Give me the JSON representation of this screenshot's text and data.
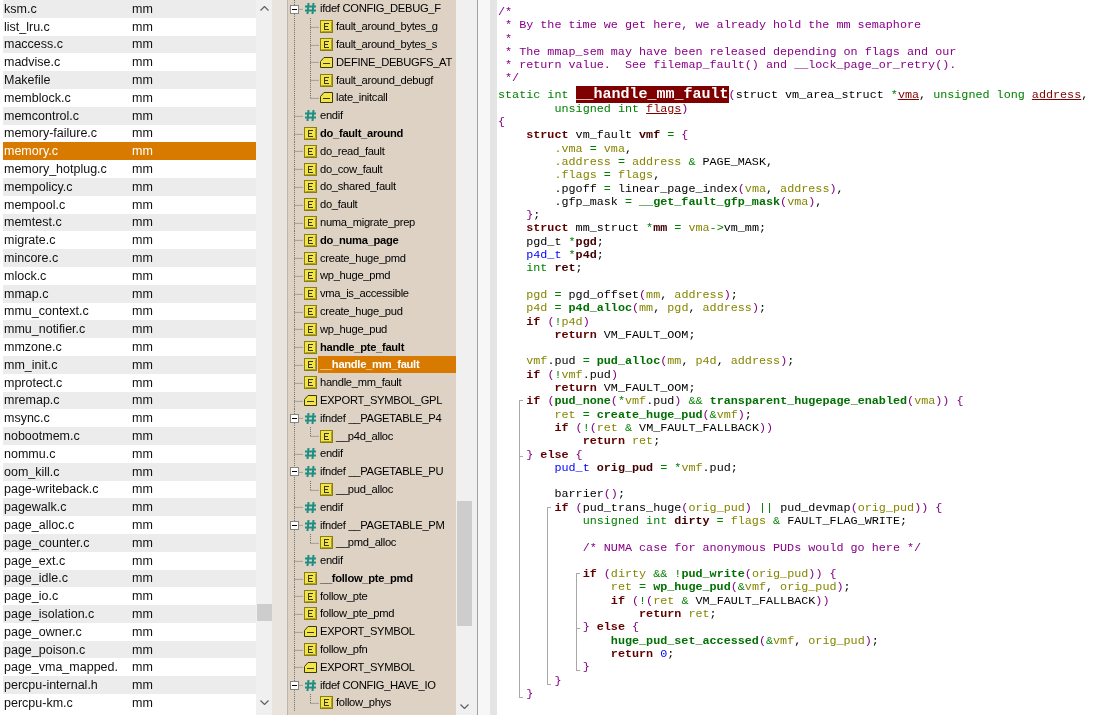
{
  "file_list": {
    "rows": [
      {
        "column_1": "ksm.c",
        "column_2": "mm",
        "selected": false
      },
      {
        "column_1": "list_lru.c",
        "column_2": "mm",
        "selected": false
      },
      {
        "column_1": "maccess.c",
        "column_2": "mm",
        "selected": false
      },
      {
        "column_1": "madvise.c",
        "column_2": "mm",
        "selected": false
      },
      {
        "column_1": "Makefile",
        "column_2": "mm",
        "selected": false
      },
      {
        "column_1": "memblock.c",
        "column_2": "mm",
        "selected": false
      },
      {
        "column_1": "memcontrol.c",
        "column_2": "mm",
        "selected": false
      },
      {
        "column_1": "memory-failure.c",
        "column_2": "mm",
        "selected": false
      },
      {
        "column_1": "memory.c",
        "column_2": "mm",
        "selected": true
      },
      {
        "column_1": "memory_hotplug.c",
        "column_2": "mm",
        "selected": false
      },
      {
        "column_1": "mempolicy.c",
        "column_2": "mm",
        "selected": false
      },
      {
        "column_1": "mempool.c",
        "column_2": "mm",
        "selected": false
      },
      {
        "column_1": "memtest.c",
        "column_2": "mm",
        "selected": false
      },
      {
        "column_1": "migrate.c",
        "column_2": "mm",
        "selected": false
      },
      {
        "column_1": "mincore.c",
        "column_2": "mm",
        "selected": false
      },
      {
        "column_1": "mlock.c",
        "column_2": "mm",
        "selected": false
      },
      {
        "column_1": "mmap.c",
        "column_2": "mm",
        "selected": false
      },
      {
        "column_1": "mmu_context.c",
        "column_2": "mm",
        "selected": false
      },
      {
        "column_1": "mmu_notifier.c",
        "column_2": "mm",
        "selected": false
      },
      {
        "column_1": "mmzone.c",
        "column_2": "mm",
        "selected": false
      },
      {
        "column_1": "mm_init.c",
        "column_2": "mm",
        "selected": false
      },
      {
        "column_1": "mprotect.c",
        "column_2": "mm",
        "selected": false
      },
      {
        "column_1": "mremap.c",
        "column_2": "mm",
        "selected": false
      },
      {
        "column_1": "msync.c",
        "column_2": "mm",
        "selected": false
      },
      {
        "column_1": "nobootmem.c",
        "column_2": "mm",
        "selected": false
      },
      {
        "column_1": "nommu.c",
        "column_2": "mm",
        "selected": false
      },
      {
        "column_1": "oom_kill.c",
        "column_2": "mm",
        "selected": false
      },
      {
        "column_1": "page-writeback.c",
        "column_2": "mm",
        "selected": false
      },
      {
        "column_1": "pagewalk.c",
        "column_2": "mm",
        "selected": false
      },
      {
        "column_1": "page_alloc.c",
        "column_2": "mm",
        "selected": false
      },
      {
        "column_1": "page_counter.c",
        "column_2": "mm",
        "selected": false
      },
      {
        "column_1": "page_ext.c",
        "column_2": "mm",
        "selected": false
      },
      {
        "column_1": "page_idle.c",
        "column_2": "mm",
        "selected": false
      },
      {
        "column_1": "page_io.c",
        "column_2": "mm",
        "selected": false
      },
      {
        "column_1": "page_isolation.c",
        "column_2": "mm",
        "selected": false
      },
      {
        "column_1": "page_owner.c",
        "column_2": "mm",
        "selected": false
      },
      {
        "column_1": "page_poison.c",
        "column_2": "mm",
        "selected": false
      },
      {
        "column_1": "page_vma_mapped.",
        "column_2": "mm",
        "selected": false
      },
      {
        "column_1": "percpu-internal.h",
        "column_2": "mm",
        "selected": false
      },
      {
        "column_1": "percpu-km.c",
        "column_2": "mm",
        "selected": false
      }
    ]
  },
  "symbol_tree": {
    "items": [
      {
        "label": "ifdef CONFIG_DEBUG_F",
        "kind": "preprocessor",
        "bold": false,
        "selected": false,
        "expanded": true,
        "children": [
          {
            "label": "fault_around_bytes_g",
            "kind": "function",
            "bold": false,
            "selected": false
          },
          {
            "label": "fault_around_bytes_s",
            "kind": "function",
            "bold": false,
            "selected": false
          },
          {
            "label": "DEFINE_DEBUGFS_AT",
            "kind": "macro",
            "bold": false,
            "selected": false
          },
          {
            "label": "fault_around_debugf",
            "kind": "function",
            "bold": false,
            "selected": false
          },
          {
            "label": "late_initcall",
            "kind": "macro",
            "bold": false,
            "selected": false
          }
        ]
      },
      {
        "label": "endif",
        "kind": "preprocessor",
        "bold": false,
        "selected": false
      },
      {
        "label": "do_fault_around",
        "kind": "function",
        "bold": true,
        "selected": false
      },
      {
        "label": "do_read_fault",
        "kind": "function",
        "bold": false,
        "selected": false
      },
      {
        "label": "do_cow_fault",
        "kind": "function",
        "bold": false,
        "selected": false
      },
      {
        "label": "do_shared_fault",
        "kind": "function",
        "bold": false,
        "selected": false
      },
      {
        "label": "do_fault",
        "kind": "function",
        "bold": false,
        "selected": false
      },
      {
        "label": "numa_migrate_prep",
        "kind": "function",
        "bold": false,
        "selected": false
      },
      {
        "label": "do_numa_page",
        "kind": "function",
        "bold": true,
        "selected": false
      },
      {
        "label": "create_huge_pmd",
        "kind": "function",
        "bold": false,
        "selected": false
      },
      {
        "label": "wp_huge_pmd",
        "kind": "function",
        "bold": false,
        "selected": false
      },
      {
        "label": "vma_is_accessible",
        "kind": "function",
        "bold": false,
        "selected": false
      },
      {
        "label": "create_huge_pud",
        "kind": "function",
        "bold": false,
        "selected": false
      },
      {
        "label": "wp_huge_pud",
        "kind": "function",
        "bold": false,
        "selected": false
      },
      {
        "label": "handle_pte_fault",
        "kind": "function",
        "bold": true,
        "selected": false
      },
      {
        "label": "__handle_mm_fault",
        "kind": "function",
        "bold": true,
        "selected": true
      },
      {
        "label": "handle_mm_fault",
        "kind": "function",
        "bold": false,
        "selected": false
      },
      {
        "label": "EXPORT_SYMBOL_GPL",
        "kind": "macro",
        "bold": false,
        "selected": false
      },
      {
        "label": "ifndef __PAGETABLE_P4",
        "kind": "preprocessor",
        "bold": false,
        "selected": false,
        "expanded": true,
        "children": [
          {
            "label": "__p4d_alloc",
            "kind": "function",
            "bold": false,
            "selected": false
          }
        ]
      },
      {
        "label": "endif",
        "kind": "preprocessor",
        "bold": false,
        "selected": false
      },
      {
        "label": "ifndef __PAGETABLE_PU",
        "kind": "preprocessor",
        "bold": false,
        "selected": false,
        "expanded": true,
        "children": [
          {
            "label": "__pud_alloc",
            "kind": "function",
            "bold": false,
            "selected": false
          }
        ]
      },
      {
        "label": "endif",
        "kind": "preprocessor",
        "bold": false,
        "selected": false
      },
      {
        "label": "ifndef __PAGETABLE_PM",
        "kind": "preprocessor",
        "bold": false,
        "selected": false,
        "expanded": true,
        "children": [
          {
            "label": "__pmd_alloc",
            "kind": "function",
            "bold": false,
            "selected": false
          }
        ]
      },
      {
        "label": "endif",
        "kind": "preprocessor",
        "bold": false,
        "selected": false
      },
      {
        "label": "__follow_pte_pmd",
        "kind": "function",
        "bold": true,
        "selected": false
      },
      {
        "label": "follow_pte",
        "kind": "function",
        "bold": false,
        "selected": false
      },
      {
        "label": "follow_pte_pmd",
        "kind": "function",
        "bold": false,
        "selected": false
      },
      {
        "label": "EXPORT_SYMBOL",
        "kind": "macro",
        "bold": false,
        "selected": false
      },
      {
        "label": "follow_pfn",
        "kind": "function",
        "bold": false,
        "selected": false
      },
      {
        "label": "EXPORT_SYMBOL",
        "kind": "macro",
        "bold": false,
        "selected": false
      },
      {
        "label": "ifdef CONFIG_HAVE_IO",
        "kind": "preprocessor",
        "bold": false,
        "selected": false,
        "expanded": true,
        "children": [
          {
            "label": "follow_phys",
            "kind": "function",
            "bold": false,
            "selected": false
          }
        ]
      }
    ]
  },
  "code": {
    "lines": [
      {
        "kind": "code",
        "tokens": [
          {
            "kind": "comment",
            "text": "/*"
          }
        ]
      },
      {
        "kind": "code",
        "tokens": [
          {
            "kind": "comment",
            "text": " * By the time we get here, we already hold the mm semaphore"
          }
        ]
      },
      {
        "kind": "code",
        "tokens": [
          {
            "kind": "comment",
            "text": " *"
          }
        ]
      },
      {
        "kind": "code",
        "tokens": [
          {
            "kind": "comment",
            "text": " * The mmap_sem may have been released depending on flags and our"
          }
        ]
      },
      {
        "kind": "code",
        "tokens": [
          {
            "kind": "comment",
            "text": " * return value.  See filemap_fault() and __lock_page_or_retry()."
          }
        ]
      },
      {
        "kind": "code",
        "tokens": [
          {
            "kind": "comment",
            "text": " */"
          }
        ]
      },
      {
        "kind": "code",
        "tokens": [
          {
            "kind": "type",
            "text": "static int "
          },
          {
            "kind": "definition",
            "text": "__handle_mm_fault"
          },
          {
            "kind": "paren",
            "text": "("
          },
          {
            "kind": "plain",
            "text": "struct vm_area_struct "
          },
          {
            "kind": "op",
            "text": "*"
          },
          {
            "kind": "param",
            "text": "vma"
          },
          {
            "kind": "plain",
            "text": ", "
          },
          {
            "kind": "type",
            "text": "unsigned long "
          },
          {
            "kind": "param",
            "text": "address"
          },
          {
            "kind": "plain",
            "text": ","
          }
        ]
      },
      {
        "kind": "code",
        "tokens": [
          {
            "kind": "type",
            "text": "\t\tunsigned int "
          },
          {
            "kind": "param",
            "text": "flags"
          },
          {
            "kind": "paren",
            "text": ")"
          }
        ]
      },
      {
        "kind": "code",
        "tokens": [
          {
            "kind": "paren",
            "text": "{"
          }
        ]
      },
      {
        "kind": "code",
        "tokens": [
          {
            "kind": "keyword",
            "text": "\tstruct"
          },
          {
            "kind": "plain",
            "text": " vm_fault "
          },
          {
            "kind": "decl",
            "text": "vmf"
          },
          {
            "kind": "op",
            "text": " = "
          },
          {
            "kind": "paren",
            "text": "{"
          }
        ]
      },
      {
        "kind": "code",
        "tokens": [
          {
            "kind": "ref",
            "text": "\t\t.vma"
          },
          {
            "kind": "op",
            "text": " = "
          },
          {
            "kind": "ref",
            "text": "vma"
          },
          {
            "kind": "plain",
            "text": ","
          }
        ]
      },
      {
        "kind": "code",
        "tokens": [
          {
            "kind": "ref",
            "text": "\t\t.address"
          },
          {
            "kind": "op",
            "text": " = "
          },
          {
            "kind": "ref",
            "text": "address"
          },
          {
            "kind": "op",
            "text": " & "
          },
          {
            "kind": "plain",
            "text": "PAGE_MASK,"
          }
        ]
      },
      {
        "kind": "code",
        "tokens": [
          {
            "kind": "ref",
            "text": "\t\t.flags"
          },
          {
            "kind": "op",
            "text": " = "
          },
          {
            "kind": "ref",
            "text": "flags"
          },
          {
            "kind": "plain",
            "text": ","
          }
        ]
      },
      {
        "kind": "code",
        "tokens": [
          {
            "kind": "plain",
            "text": "\t\t.pgoff"
          },
          {
            "kind": "op",
            "text": " = "
          },
          {
            "kind": "plain",
            "text": "linear_page_index"
          },
          {
            "kind": "paren",
            "text": "("
          },
          {
            "kind": "ref",
            "text": "vma"
          },
          {
            "kind": "plain",
            "text": ", "
          },
          {
            "kind": "ref",
            "text": "address"
          },
          {
            "kind": "paren",
            "text": ")"
          },
          {
            "kind": "plain",
            "text": ","
          }
        ]
      },
      {
        "kind": "code",
        "tokens": [
          {
            "kind": "plain",
            "text": "\t\t.gfp_mask"
          },
          {
            "kind": "op",
            "text": " = "
          },
          {
            "kind": "call",
            "text": "__get_fault_gfp_mask"
          },
          {
            "kind": "paren",
            "text": "("
          },
          {
            "kind": "ref",
            "text": "vma"
          },
          {
            "kind": "paren",
            "text": ")"
          },
          {
            "kind": "plain",
            "text": ","
          }
        ]
      },
      {
        "kind": "code",
        "tokens": [
          {
            "kind": "paren",
            "text": "\t}"
          },
          {
            "kind": "plain",
            "text": ";"
          }
        ]
      },
      {
        "kind": "code",
        "tokens": [
          {
            "kind": "keyword",
            "text": "\tstruct"
          },
          {
            "kind": "plain",
            "text": " mm_struct "
          },
          {
            "kind": "op",
            "text": "*"
          },
          {
            "kind": "decl",
            "text": "mm"
          },
          {
            "kind": "op",
            "text": " = "
          },
          {
            "kind": "ref",
            "text": "vma"
          },
          {
            "kind": "op",
            "text": "->"
          },
          {
            "kind": "plain",
            "text": "vm_mm;"
          }
        ]
      },
      {
        "kind": "code",
        "tokens": [
          {
            "kind": "plain",
            "text": "\tpgd_t "
          },
          {
            "kind": "op",
            "text": "*"
          },
          {
            "kind": "decl",
            "text": "pgd"
          },
          {
            "kind": "plain",
            "text": ";"
          }
        ]
      },
      {
        "kind": "code",
        "tokens": [
          {
            "kind": "typedef",
            "text": "\tp4d_t "
          },
          {
            "kind": "op",
            "text": "*"
          },
          {
            "kind": "decl",
            "text": "p4d"
          },
          {
            "kind": "plain",
            "text": ";"
          }
        ]
      },
      {
        "kind": "code",
        "tokens": [
          {
            "kind": "type",
            "text": "\tint "
          },
          {
            "kind": "decl",
            "text": "ret"
          },
          {
            "kind": "plain",
            "text": ";"
          }
        ]
      },
      {
        "kind": "blank"
      },
      {
        "kind": "code",
        "tokens": [
          {
            "kind": "ref",
            "text": "\tpgd"
          },
          {
            "kind": "op",
            "text": " = "
          },
          {
            "kind": "plain",
            "text": "pgd_offset"
          },
          {
            "kind": "paren",
            "text": "("
          },
          {
            "kind": "ref",
            "text": "mm"
          },
          {
            "kind": "plain",
            "text": ", "
          },
          {
            "kind": "ref",
            "text": "address"
          },
          {
            "kind": "paren",
            "text": ")"
          },
          {
            "kind": "plain",
            "text": ";"
          }
        ]
      },
      {
        "kind": "code",
        "tokens": [
          {
            "kind": "ref",
            "text": "\tp4d"
          },
          {
            "kind": "op",
            "text": " = "
          },
          {
            "kind": "call",
            "text": "p4d_alloc"
          },
          {
            "kind": "paren",
            "text": "("
          },
          {
            "kind": "ref",
            "text": "mm"
          },
          {
            "kind": "plain",
            "text": ", "
          },
          {
            "kind": "ref",
            "text": "pgd"
          },
          {
            "kind": "plain",
            "text": ", "
          },
          {
            "kind": "ref",
            "text": "address"
          },
          {
            "kind": "paren",
            "text": ")"
          },
          {
            "kind": "plain",
            "text": ";"
          }
        ]
      },
      {
        "kind": "code",
        "tokens": [
          {
            "kind": "keyword",
            "text": "\tif "
          },
          {
            "kind": "paren",
            "text": "("
          },
          {
            "kind": "op",
            "text": "!"
          },
          {
            "kind": "ref",
            "text": "p4d"
          },
          {
            "kind": "paren",
            "text": ")"
          }
        ]
      },
      {
        "kind": "code",
        "tokens": [
          {
            "kind": "keyword",
            "text": "\t\treturn"
          },
          {
            "kind": "plain",
            "text": " VM_FAULT_OOM;"
          }
        ]
      },
      {
        "kind": "blank"
      },
      {
        "kind": "code",
        "tokens": [
          {
            "kind": "ref",
            "text": "\tvmf"
          },
          {
            "kind": "plain",
            "text": ".pud"
          },
          {
            "kind": "op",
            "text": " = "
          },
          {
            "kind": "call",
            "text": "pud_alloc"
          },
          {
            "kind": "paren",
            "text": "("
          },
          {
            "kind": "ref",
            "text": "mm"
          },
          {
            "kind": "plain",
            "text": ", "
          },
          {
            "kind": "ref",
            "text": "p4d"
          },
          {
            "kind": "plain",
            "text": ", "
          },
          {
            "kind": "ref",
            "text": "address"
          },
          {
            "kind": "paren",
            "text": ")"
          },
          {
            "kind": "plain",
            "text": ";"
          }
        ]
      },
      {
        "kind": "code",
        "tokens": [
          {
            "kind": "keyword",
            "text": "\tif "
          },
          {
            "kind": "paren",
            "text": "("
          },
          {
            "kind": "op",
            "text": "!"
          },
          {
            "kind": "ref",
            "text": "vmf"
          },
          {
            "kind": "plain",
            "text": ".pud"
          },
          {
            "kind": "paren",
            "text": ")"
          }
        ]
      },
      {
        "kind": "code",
        "tokens": [
          {
            "kind": "keyword",
            "text": "\t\treturn"
          },
          {
            "kind": "plain",
            "text": " VM_FAULT_OOM;"
          }
        ]
      },
      {
        "kind": "code",
        "tokens": [
          {
            "kind": "keyword",
            "text": "\tif "
          },
          {
            "kind": "paren",
            "text": "("
          },
          {
            "kind": "call",
            "text": "pud_none"
          },
          {
            "kind": "paren",
            "text": "("
          },
          {
            "kind": "op",
            "text": "*"
          },
          {
            "kind": "ref",
            "text": "vmf"
          },
          {
            "kind": "plain",
            "text": ".pud"
          },
          {
            "kind": "paren",
            "text": ")"
          },
          {
            "kind": "op",
            "text": " && "
          },
          {
            "kind": "call",
            "text": "transparent_hugepage_enabled"
          },
          {
            "kind": "paren",
            "text": "("
          },
          {
            "kind": "ref",
            "text": "vma"
          },
          {
            "kind": "paren",
            "text": ")) {"
          }
        ]
      },
      {
        "kind": "code",
        "tokens": [
          {
            "kind": "ref",
            "text": "\t\tret"
          },
          {
            "kind": "op",
            "text": " = "
          },
          {
            "kind": "call",
            "text": "create_huge_pud"
          },
          {
            "kind": "paren",
            "text": "("
          },
          {
            "kind": "op",
            "text": "&"
          },
          {
            "kind": "ref",
            "text": "vmf"
          },
          {
            "kind": "paren",
            "text": ")"
          },
          {
            "kind": "plain",
            "text": ";"
          }
        ]
      },
      {
        "kind": "code",
        "tokens": [
          {
            "kind": "keyword",
            "text": "\t\tif "
          },
          {
            "kind": "paren",
            "text": "("
          },
          {
            "kind": "op",
            "text": "!"
          },
          {
            "kind": "paren",
            "text": "("
          },
          {
            "kind": "ref",
            "text": "ret"
          },
          {
            "kind": "op",
            "text": " & "
          },
          {
            "kind": "plain",
            "text": "VM_FAULT_FALLBACK"
          },
          {
            "kind": "paren",
            "text": "))"
          }
        ]
      },
      {
        "kind": "code",
        "tokens": [
          {
            "kind": "keyword",
            "text": "\t\t\treturn "
          },
          {
            "kind": "ref",
            "text": "ret"
          },
          {
            "kind": "plain",
            "text": ";"
          }
        ]
      },
      {
        "kind": "code",
        "tokens": [
          {
            "kind": "paren",
            "text": "\t} "
          },
          {
            "kind": "keyword",
            "text": "else "
          },
          {
            "kind": "paren",
            "text": "{"
          }
        ]
      },
      {
        "kind": "code",
        "tokens": [
          {
            "kind": "typedef",
            "text": "\t\tpud_t "
          },
          {
            "kind": "decl",
            "text": "orig_pud"
          },
          {
            "kind": "op",
            "text": " = *"
          },
          {
            "kind": "ref",
            "text": "vmf"
          },
          {
            "kind": "plain",
            "text": ".pud;"
          }
        ]
      },
      {
        "kind": "blank"
      },
      {
        "kind": "code",
        "tokens": [
          {
            "kind": "plain",
            "text": "\t\tbarrier"
          },
          {
            "kind": "paren",
            "text": "()"
          },
          {
            "kind": "plain",
            "text": ";"
          }
        ]
      },
      {
        "kind": "code",
        "tokens": [
          {
            "kind": "keyword",
            "text": "\t\tif "
          },
          {
            "kind": "paren",
            "text": "("
          },
          {
            "kind": "plain",
            "text": "pud_trans_huge"
          },
          {
            "kind": "paren",
            "text": "("
          },
          {
            "kind": "ref",
            "text": "orig_pud"
          },
          {
            "kind": "paren",
            "text": ")"
          },
          {
            "kind": "op",
            "text": " || "
          },
          {
            "kind": "plain",
            "text": "pud_devmap"
          },
          {
            "kind": "paren",
            "text": "("
          },
          {
            "kind": "ref",
            "text": "orig_pud"
          },
          {
            "kind": "paren",
            "text": ")) {"
          }
        ]
      },
      {
        "kind": "code",
        "tokens": [
          {
            "kind": "type",
            "text": "\t\t\tunsigned int "
          },
          {
            "kind": "decl",
            "text": "dirty"
          },
          {
            "kind": "op",
            "text": " = "
          },
          {
            "kind": "ref",
            "text": "flags"
          },
          {
            "kind": "op",
            "text": " & "
          },
          {
            "kind": "plain",
            "text": "FAULT_FLAG_WRITE;"
          }
        ]
      },
      {
        "kind": "blank"
      },
      {
        "kind": "code",
        "tokens": [
          {
            "kind": "comment",
            "text": "\t\t\t/* NUMA case for anonymous PUDs would go here */"
          }
        ]
      },
      {
        "kind": "blank"
      },
      {
        "kind": "code",
        "tokens": [
          {
            "kind": "keyword",
            "text": "\t\t\tif "
          },
          {
            "kind": "paren",
            "text": "("
          },
          {
            "kind": "ref",
            "text": "dirty"
          },
          {
            "kind": "op",
            "text": " && !"
          },
          {
            "kind": "call",
            "text": "pud_write"
          },
          {
            "kind": "paren",
            "text": "("
          },
          {
            "kind": "ref",
            "text": "orig_pud"
          },
          {
            "kind": "paren",
            "text": ")) {"
          }
        ]
      },
      {
        "kind": "code",
        "tokens": [
          {
            "kind": "ref",
            "text": "\t\t\t\tret"
          },
          {
            "kind": "op",
            "text": " = "
          },
          {
            "kind": "call",
            "text": "wp_huge_pud"
          },
          {
            "kind": "paren",
            "text": "("
          },
          {
            "kind": "op",
            "text": "&"
          },
          {
            "kind": "ref",
            "text": "vmf"
          },
          {
            "kind": "plain",
            "text": ", "
          },
          {
            "kind": "ref",
            "text": "orig_pud"
          },
          {
            "kind": "paren",
            "text": ")"
          },
          {
            "kind": "plain",
            "text": ";"
          }
        ]
      },
      {
        "kind": "code",
        "tokens": [
          {
            "kind": "keyword",
            "text": "\t\t\t\tif "
          },
          {
            "kind": "paren",
            "text": "("
          },
          {
            "kind": "op",
            "text": "!"
          },
          {
            "kind": "paren",
            "text": "("
          },
          {
            "kind": "ref",
            "text": "ret"
          },
          {
            "kind": "op",
            "text": " & "
          },
          {
            "kind": "plain",
            "text": "VM_FAULT_FALLBACK"
          },
          {
            "kind": "paren",
            "text": "))"
          }
        ]
      },
      {
        "kind": "code",
        "tokens": [
          {
            "kind": "keyword",
            "text": "\t\t\t\t\treturn "
          },
          {
            "kind": "ref",
            "text": "ret"
          },
          {
            "kind": "plain",
            "text": ";"
          }
        ]
      },
      {
        "kind": "code",
        "tokens": [
          {
            "kind": "paren",
            "text": "\t\t\t} "
          },
          {
            "kind": "keyword",
            "text": "else "
          },
          {
            "kind": "paren",
            "text": "{"
          }
        ]
      },
      {
        "kind": "code",
        "tokens": [
          {
            "kind": "call",
            "text": "\t\t\t\thuge_pud_set_accessed"
          },
          {
            "kind": "paren",
            "text": "("
          },
          {
            "kind": "op",
            "text": "&"
          },
          {
            "kind": "ref",
            "text": "vmf"
          },
          {
            "kind": "plain",
            "text": ", "
          },
          {
            "kind": "ref",
            "text": "orig_pud"
          },
          {
            "kind": "paren",
            "text": ")"
          },
          {
            "kind": "plain",
            "text": ";"
          }
        ]
      },
      {
        "kind": "code",
        "tokens": [
          {
            "kind": "keyword",
            "text": "\t\t\t\treturn "
          },
          {
            "kind": "number",
            "text": "0"
          },
          {
            "kind": "plain",
            "text": ";"
          }
        ]
      },
      {
        "kind": "code",
        "tokens": [
          {
            "kind": "paren",
            "text": "\t\t\t}"
          }
        ]
      },
      {
        "kind": "code",
        "tokens": [
          {
            "kind": "paren",
            "text": "\t\t}"
          }
        ]
      },
      {
        "kind": "code",
        "tokens": [
          {
            "kind": "paren",
            "text": "\t}"
          }
        ]
      }
    ]
  }
}
